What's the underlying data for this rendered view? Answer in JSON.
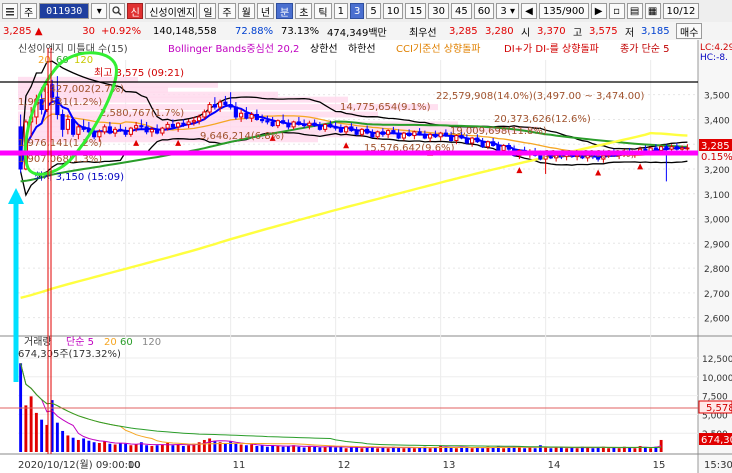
{
  "toolbar": {
    "unit": "주",
    "code": "011930",
    "name": "신성이엔지",
    "periods": [
      "틱",
      "분",
      "일",
      "주",
      "월",
      "년",
      "분",
      "초",
      "틱"
    ],
    "period_labels": [
      "일",
      "주",
      "월",
      "년",
      "분",
      "초",
      "틱"
    ],
    "selected_period": "분",
    "intervals": [
      "1",
      "3",
      "5",
      "10",
      "15",
      "30",
      "45",
      "60"
    ],
    "selected_interval": "3",
    "interval_select": "3",
    "count": "135/900",
    "date": "10/12"
  },
  "quote": {
    "price": "3,285",
    "change": "30",
    "change_pct": "+0.92%",
    "volume": "140,148,558",
    "ratio1": "72.88%",
    "ratio2": "73.13%",
    "amount": "474,349백만",
    "best_ask_label": "최우선",
    "best_ask": "3,285",
    "best_bid": "3,280",
    "open_label": "시",
    "open": "3,370",
    "high_label": "고",
    "high": "3,575",
    "low_label": "저",
    "low": "3,185",
    "buy_button": "매수"
  },
  "legend": {
    "name": "신성이엔지 미틀대 수(15)",
    "bollinger": "Bollinger Bands중심선 20,2",
    "upper": "상한선",
    "lower": "하한선",
    "cci": "CCI기준선 상향돌파",
    "dmi": "DI+가 DI-를 상향돌파",
    "ma": "종가 단순 5",
    "ma_periods": [
      "20",
      "60",
      "120"
    ],
    "lc": "LC:4.29",
    "hc": "HC:-8."
  },
  "annotations": {
    "high": "최고 3,575 (09:21)",
    "low": "최저 3,150 (15:09)",
    "a1": "4,427,002(2.7%)",
    "a2": "1,937,531(1.2%)",
    "a3": "2,580,767(1.7%)",
    "a4": "1,976,141(1.2%)",
    "a5": "1,907,068(1.3%)",
    "a6": "9,646,214(6.8%)",
    "a7": "14,775,654(9.1%)",
    "a8": "22,579,908(14.0%)(3,497.00 ~ 3,474.00)",
    "a9": "20,373,626(12.6%)",
    "a10": "15,576,642(9.6%)",
    "a11": "19,009,698(11.8%)",
    "a12": "11,214,606(6.9%)",
    "price_box": "3,285",
    "price_pct": "0.15%"
  },
  "volume_panel": {
    "title": "거래량",
    "ma_label": "단순 5",
    "ma_periods": [
      "20",
      "60",
      "120"
    ],
    "max_label": "674,305주(173.32%)",
    "box1": "5,578",
    "box2": "674,30"
  },
  "x_axis": {
    "start": "2020/10/12(월) 09:00:00",
    "labels": [
      "10",
      "11",
      "12",
      "13",
      "14",
      "15"
    ],
    "end": "15:30"
  },
  "colors": {
    "candle_up": "#e00000",
    "candle_down": "#0000ff",
    "bollinger_mid": "#000000",
    "ma5": "#0000ff",
    "ma20": "#f5a623",
    "ma60": "#2a9d2a",
    "ma120": "#ffff40",
    "magenta": "#ff00ff",
    "cyan": "#00e0ff",
    "green_annot": "#33ee33"
  },
  "chart_data": {
    "type": "candlestick",
    "title": "신성이엔지",
    "interval": "3분",
    "price_axis": [
      "3,500",
      "3,400",
      "3,300",
      "3,200",
      "3,100",
      "3,000",
      "2,900",
      "2,800",
      "2,700",
      "2,600"
    ],
    "price_ylim": [
      2550,
      3640
    ],
    "volume_axis": [
      "12,500",
      "10,000",
      "7,500",
      "5,000",
      "2,500"
    ],
    "volume_ylim": [
      0,
      12500
    ],
    "x_ticks": [
      "10",
      "11",
      "12",
      "13",
      "14",
      "15"
    ],
    "candles": [
      {
        "t": "09:00",
        "o": 3370,
        "h": 3420,
        "l": 3185,
        "c": 3200
      },
      {
        "t": "09:03",
        "o": 3200,
        "h": 3400,
        "l": 3195,
        "c": 3390
      },
      {
        "t": "09:06",
        "o": 3390,
        "h": 3450,
        "l": 3330,
        "c": 3410
      },
      {
        "t": "09:09",
        "o": 3410,
        "h": 3500,
        "l": 3380,
        "c": 3480
      },
      {
        "t": "09:12",
        "o": 3480,
        "h": 3530,
        "l": 3420,
        "c": 3440
      },
      {
        "t": "09:15",
        "o": 3440,
        "h": 3560,
        "l": 3430,
        "c": 3540
      },
      {
        "t": "09:18",
        "o": 3540,
        "h": 3560,
        "l": 3470,
        "c": 3490
      },
      {
        "t": "09:21",
        "o": 3490,
        "h": 3575,
        "l": 3400,
        "c": 3420
      },
      {
        "t": "09:24",
        "o": 3420,
        "h": 3440,
        "l": 3330,
        "c": 3360
      },
      {
        "t": "09:27",
        "o": 3360,
        "h": 3420,
        "l": 3340,
        "c": 3400
      },
      {
        "t": "09:30",
        "o": 3400,
        "h": 3410,
        "l": 3330,
        "c": 3340
      },
      {
        "t": "09:33",
        "o": 3340,
        "h": 3380,
        "l": 3320,
        "c": 3370
      },
      {
        "t": "09:36",
        "o": 3370,
        "h": 3400,
        "l": 3350,
        "c": 3360
      },
      {
        "t": "09:39",
        "o": 3360,
        "h": 3390,
        "l": 3330,
        "c": 3350
      },
      {
        "t": "09:42",
        "o": 3350,
        "h": 3370,
        "l": 3320,
        "c": 3330
      },
      {
        "t": "09:45",
        "o": 3330,
        "h": 3360,
        "l": 3310,
        "c": 3350
      },
      {
        "t": "09:48",
        "o": 3350,
        "h": 3380,
        "l": 3340,
        "c": 3370
      },
      {
        "t": "09:51",
        "o": 3370,
        "h": 3390,
        "l": 3340,
        "c": 3345
      },
      {
        "t": "09:54",
        "o": 3345,
        "h": 3370,
        "l": 3330,
        "c": 3360
      },
      {
        "t": "09:57",
        "o": 3360,
        "h": 3380,
        "l": 3350,
        "c": 3355
      },
      {
        "t": "10:00",
        "o": 3355,
        "h": 3370,
        "l": 3330,
        "c": 3340
      },
      {
        "t": "10:03",
        "o": 3340,
        "h": 3370,
        "l": 3330,
        "c": 3365
      },
      {
        "t": "10:06",
        "o": 3365,
        "h": 3390,
        "l": 3350,
        "c": 3375
      },
      {
        "t": "10:09",
        "o": 3375,
        "h": 3400,
        "l": 3360,
        "c": 3370
      },
      {
        "t": "10:12",
        "o": 3370,
        "h": 3390,
        "l": 3340,
        "c": 3350
      },
      {
        "t": "10:15",
        "o": 3350,
        "h": 3370,
        "l": 3330,
        "c": 3360
      },
      {
        "t": "10:18",
        "o": 3360,
        "h": 3380,
        "l": 3340,
        "c": 3345
      },
      {
        "t": "10:21",
        "o": 3345,
        "h": 3370,
        "l": 3335,
        "c": 3365
      },
      {
        "t": "10:24",
        "o": 3365,
        "h": 3390,
        "l": 3355,
        "c": 3380
      },
      {
        "t": "10:27",
        "o": 3380,
        "h": 3400,
        "l": 3360,
        "c": 3370
      },
      {
        "t": "10:30",
        "o": 3370,
        "h": 3390,
        "l": 3350,
        "c": 3385
      },
      {
        "t": "10:33",
        "o": 3385,
        "h": 3400,
        "l": 3370,
        "c": 3380
      },
      {
        "t": "10:36",
        "o": 3380,
        "h": 3400,
        "l": 3365,
        "c": 3390
      },
      {
        "t": "10:39",
        "o": 3390,
        "h": 3410,
        "l": 3375,
        "c": 3395
      },
      {
        "t": "10:42",
        "o": 3395,
        "h": 3420,
        "l": 3380,
        "c": 3410
      },
      {
        "t": "10:45",
        "o": 3410,
        "h": 3440,
        "l": 3400,
        "c": 3430
      },
      {
        "t": "10:48",
        "o": 3430,
        "h": 3470,
        "l": 3420,
        "c": 3460
      },
      {
        "t": "10:51",
        "o": 3460,
        "h": 3490,
        "l": 3440,
        "c": 3450
      },
      {
        "t": "10:54",
        "o": 3450,
        "h": 3480,
        "l": 3430,
        "c": 3470
      },
      {
        "t": "10:57",
        "o": 3470,
        "h": 3495,
        "l": 3450,
        "c": 3460
      },
      {
        "t": "11:00",
        "o": 3460,
        "h": 3510,
        "l": 3440,
        "c": 3450
      },
      {
        "t": "11:03",
        "o": 3450,
        "h": 3470,
        "l": 3400,
        "c": 3410
      },
      {
        "t": "11:06",
        "o": 3410,
        "h": 3440,
        "l": 3390,
        "c": 3425
      },
      {
        "t": "11:09",
        "o": 3425,
        "h": 3450,
        "l": 3400,
        "c": 3405
      },
      {
        "t": "11:12",
        "o": 3405,
        "h": 3430,
        "l": 3390,
        "c": 3420
      },
      {
        "t": "11:15",
        "o": 3420,
        "h": 3440,
        "l": 3395,
        "c": 3400
      },
      {
        "t": "11:18",
        "o": 3400,
        "h": 3420,
        "l": 3385,
        "c": 3395
      },
      {
        "t": "11:21",
        "o": 3395,
        "h": 3415,
        "l": 3380,
        "c": 3390
      },
      {
        "t": "11:24",
        "o": 3390,
        "h": 3410,
        "l": 3370,
        "c": 3375
      },
      {
        "t": "11:27",
        "o": 3375,
        "h": 3400,
        "l": 3365,
        "c": 3395
      },
      {
        "t": "11:30",
        "o": 3395,
        "h": 3420,
        "l": 3380,
        "c": 3385
      },
      {
        "t": "11:33",
        "o": 3385,
        "h": 3400,
        "l": 3360,
        "c": 3370
      },
      {
        "t": "11:36",
        "o": 3370,
        "h": 3395,
        "l": 3360,
        "c": 3390
      },
      {
        "t": "11:39",
        "o": 3390,
        "h": 3410,
        "l": 3375,
        "c": 3380
      },
      {
        "t": "11:42",
        "o": 3380,
        "h": 3400,
        "l": 3365,
        "c": 3375
      },
      {
        "t": "11:45",
        "o": 3375,
        "h": 3395,
        "l": 3360,
        "c": 3385
      },
      {
        "t": "11:48",
        "o": 3385,
        "h": 3400,
        "l": 3370,
        "c": 3375
      },
      {
        "t": "11:51",
        "o": 3375,
        "h": 3390,
        "l": 3355,
        "c": 3360
      },
      {
        "t": "11:54",
        "o": 3360,
        "h": 3385,
        "l": 3350,
        "c": 3380
      },
      {
        "t": "11:57",
        "o": 3380,
        "h": 3395,
        "l": 3365,
        "c": 3370
      },
      {
        "t": "12:00",
        "o": 3370,
        "h": 3390,
        "l": 3355,
        "c": 3365
      },
      {
        "t": "12:03",
        "o": 3365,
        "h": 3380,
        "l": 3345,
        "c": 3350
      },
      {
        "t": "12:06",
        "o": 3350,
        "h": 3375,
        "l": 3340,
        "c": 3370
      },
      {
        "t": "12:09",
        "o": 3370,
        "h": 3385,
        "l": 3350,
        "c": 3355
      },
      {
        "t": "12:12",
        "o": 3355,
        "h": 3370,
        "l": 3335,
        "c": 3340
      },
      {
        "t": "12:15",
        "o": 3340,
        "h": 3365,
        "l": 3330,
        "c": 3360
      },
      {
        "t": "12:18",
        "o": 3360,
        "h": 3375,
        "l": 3340,
        "c": 3345
      },
      {
        "t": "12:21",
        "o": 3345,
        "h": 3360,
        "l": 3325,
        "c": 3330
      },
      {
        "t": "12:24",
        "o": 3330,
        "h": 3355,
        "l": 3320,
        "c": 3350
      },
      {
        "t": "12:27",
        "o": 3350,
        "h": 3365,
        "l": 3330,
        "c": 3340
      },
      {
        "t": "12:30",
        "o": 3340,
        "h": 3360,
        "l": 3325,
        "c": 3355
      },
      {
        "t": "12:33",
        "o": 3355,
        "h": 3370,
        "l": 3340,
        "c": 3345
      },
      {
        "t": "12:36",
        "o": 3345,
        "h": 3360,
        "l": 3320,
        "c": 3325
      },
      {
        "t": "12:39",
        "o": 3325,
        "h": 3350,
        "l": 3315,
        "c": 3345
      },
      {
        "t": "12:42",
        "o": 3345,
        "h": 3360,
        "l": 3330,
        "c": 3335
      },
      {
        "t": "12:45",
        "o": 3335,
        "h": 3355,
        "l": 3320,
        "c": 3350
      },
      {
        "t": "12:48",
        "o": 3350,
        "h": 3365,
        "l": 3335,
        "c": 3340
      },
      {
        "t": "12:51",
        "o": 3340,
        "h": 3355,
        "l": 3320,
        "c": 3325
      },
      {
        "t": "12:54",
        "o": 3325,
        "h": 3345,
        "l": 3310,
        "c": 3340
      },
      {
        "t": "12:57",
        "o": 3340,
        "h": 3355,
        "l": 3325,
        "c": 3330
      },
      {
        "t": "13:00",
        "o": 3330,
        "h": 3350,
        "l": 3315,
        "c": 3345
      },
      {
        "t": "13:03",
        "o": 3345,
        "h": 3360,
        "l": 3330,
        "c": 3335
      },
      {
        "t": "13:06",
        "o": 3335,
        "h": 3350,
        "l": 3310,
        "c": 3315
      },
      {
        "t": "13:09",
        "o": 3315,
        "h": 3340,
        "l": 3300,
        "c": 3335
      },
      {
        "t": "13:12",
        "o": 3335,
        "h": 3350,
        "l": 3320,
        "c": 3325
      },
      {
        "t": "13:15",
        "o": 3325,
        "h": 3340,
        "l": 3300,
        "c": 3305
      },
      {
        "t": "13:18",
        "o": 3305,
        "h": 3330,
        "l": 3290,
        "c": 3325
      },
      {
        "t": "13:21",
        "o": 3325,
        "h": 3340,
        "l": 3305,
        "c": 3310
      },
      {
        "t": "13:24",
        "o": 3310,
        "h": 3325,
        "l": 3285,
        "c": 3290
      },
      {
        "t": "13:27",
        "o": 3290,
        "h": 3315,
        "l": 3280,
        "c": 3310
      },
      {
        "t": "13:30",
        "o": 3310,
        "h": 3325,
        "l": 3290,
        "c": 3295
      },
      {
        "t": "13:33",
        "o": 3295,
        "h": 3310,
        "l": 3270,
        "c": 3275
      },
      {
        "t": "13:36",
        "o": 3275,
        "h": 3300,
        "l": 3260,
        "c": 3295
      },
      {
        "t": "13:39",
        "o": 3295,
        "h": 3305,
        "l": 3270,
        "c": 3280
      },
      {
        "t": "13:42",
        "o": 3280,
        "h": 3295,
        "l": 3250,
        "c": 3255
      },
      {
        "t": "13:45",
        "o": 3255,
        "h": 3280,
        "l": 3240,
        "c": 3275
      },
      {
        "t": "13:48",
        "o": 3275,
        "h": 3290,
        "l": 3255,
        "c": 3260
      },
      {
        "t": "13:51",
        "o": 3260,
        "h": 3280,
        "l": 3245,
        "c": 3270
      },
      {
        "t": "13:54",
        "o": 3270,
        "h": 3285,
        "l": 3250,
        "c": 3255
      },
      {
        "t": "13:57",
        "o": 3255,
        "h": 3275,
        "l": 3235,
        "c": 3240
      },
      {
        "t": "14:00",
        "o": 3240,
        "h": 3265,
        "l": 3180,
        "c": 3260
      },
      {
        "t": "14:03",
        "o": 3260,
        "h": 3275,
        "l": 3240,
        "c": 3245
      },
      {
        "t": "14:06",
        "o": 3245,
        "h": 3265,
        "l": 3230,
        "c": 3255
      },
      {
        "t": "14:09",
        "o": 3255,
        "h": 3270,
        "l": 3240,
        "c": 3250
      },
      {
        "t": "14:12",
        "o": 3250,
        "h": 3270,
        "l": 3235,
        "c": 3260
      },
      {
        "t": "14:15",
        "o": 3260,
        "h": 3275,
        "l": 3245,
        "c": 3250
      },
      {
        "t": "14:18",
        "o": 3250,
        "h": 3265,
        "l": 3235,
        "c": 3255
      },
      {
        "t": "14:21",
        "o": 3255,
        "h": 3270,
        "l": 3240,
        "c": 3245
      },
      {
        "t": "14:24",
        "o": 3245,
        "h": 3260,
        "l": 3230,
        "c": 3255
      },
      {
        "t": "14:27",
        "o": 3255,
        "h": 3270,
        "l": 3240,
        "c": 3250
      },
      {
        "t": "14:30",
        "o": 3250,
        "h": 3265,
        "l": 3230,
        "c": 3240
      },
      {
        "t": "14:33",
        "o": 3240,
        "h": 3260,
        "l": 3225,
        "c": 3255
      },
      {
        "t": "14:36",
        "o": 3255,
        "h": 3275,
        "l": 3245,
        "c": 3265
      },
      {
        "t": "14:39",
        "o": 3265,
        "h": 3280,
        "l": 3250,
        "c": 3255
      },
      {
        "t": "14:42",
        "o": 3255,
        "h": 3270,
        "l": 3240,
        "c": 3260
      },
      {
        "t": "14:45",
        "o": 3260,
        "h": 3280,
        "l": 3250,
        "c": 3270
      },
      {
        "t": "14:48",
        "o": 3270,
        "h": 3285,
        "l": 3255,
        "c": 3260
      },
      {
        "t": "14:51",
        "o": 3260,
        "h": 3275,
        "l": 3245,
        "c": 3265
      },
      {
        "t": "14:54",
        "o": 3265,
        "h": 3290,
        "l": 3255,
        "c": 3280
      },
      {
        "t": "14:57",
        "o": 3280,
        "h": 3295,
        "l": 3265,
        "c": 3270
      },
      {
        "t": "15:00",
        "o": 3270,
        "h": 3290,
        "l": 3260,
        "c": 3285
      },
      {
        "t": "15:03",
        "o": 3285,
        "h": 3300,
        "l": 3270,
        "c": 3275
      },
      {
        "t": "15:06",
        "o": 3275,
        "h": 3295,
        "l": 3265,
        "c": 3290
      },
      {
        "t": "15:09",
        "o": 3290,
        "h": 3300,
        "l": 3150,
        "c": 3280
      },
      {
        "t": "15:12",
        "o": 3280,
        "h": 3300,
        "l": 3270,
        "c": 3290
      },
      {
        "t": "15:15",
        "o": 3290,
        "h": 3305,
        "l": 3275,
        "c": 3280
      },
      {
        "t": "15:18",
        "o": 3280,
        "h": 3295,
        "l": 3270,
        "c": 3285
      },
      {
        "t": "15:21",
        "o": 3285,
        "h": 3300,
        "l": 3275,
        "c": 3285
      }
    ],
    "volumes": [
      11800,
      6200,
      7400,
      5200,
      4300,
      3600,
      6900,
      3900,
      2800,
      2200,
      1900,
      1600,
      1800,
      1500,
      1300,
      1200,
      1400,
      1100,
      1000,
      1200,
      1100,
      900,
      1000,
      1300,
      900,
      800,
      900,
      1000,
      1200,
      900,
      1000,
      800,
      900,
      1100,
      1300,
      1600,
      1800,
      1500,
      1300,
      1200,
      1400,
      1100,
      1000,
      900,
      1000,
      800,
      900,
      700,
      900,
      800,
      700,
      800,
      900,
      700,
      600,
      800,
      700,
      600,
      700,
      800,
      600,
      700,
      500,
      600,
      700,
      500,
      600,
      700,
      500,
      600,
      500,
      700,
      600,
      500,
      600,
      500,
      600,
      700,
      500,
      600,
      800,
      700,
      600,
      500,
      700,
      600,
      500,
      600,
      500,
      700,
      600,
      800,
      500,
      600,
      700,
      800,
      500,
      600,
      500,
      900,
      600,
      500,
      700,
      600,
      500,
      600,
      500,
      700,
      600,
      500,
      600,
      700,
      500,
      600,
      500,
      700,
      600,
      500,
      800,
      600,
      500,
      700,
      1600
    ]
  }
}
